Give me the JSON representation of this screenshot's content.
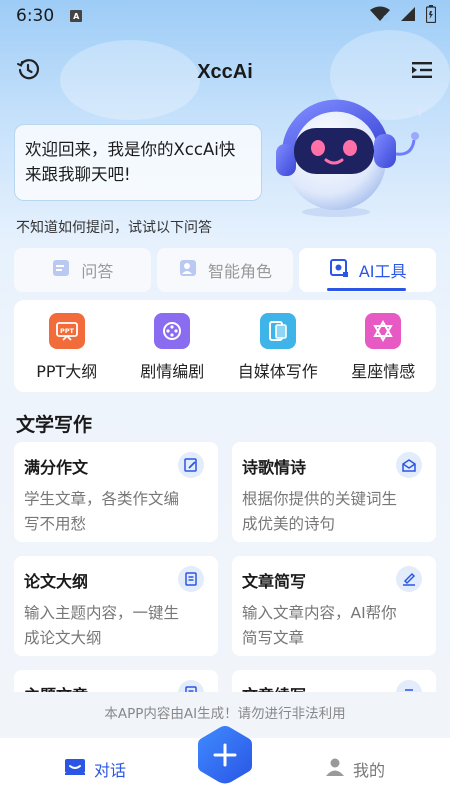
{
  "status": {
    "time": "6:30",
    "badge": "A"
  },
  "header": {
    "title": "XccAi"
  },
  "welcome": {
    "line1": "欢迎回来，我是你的XccAi快",
    "line2": "来跟我聊天吧!"
  },
  "hint": "不知道如何提问，试试以下问答",
  "tabs": [
    {
      "label": "问答",
      "icon": "qa-icon",
      "active": false
    },
    {
      "label": "智能角色",
      "icon": "role-icon",
      "active": false
    },
    {
      "label": "AI工具",
      "icon": "ai-tool-icon",
      "active": true
    }
  ],
  "tools": [
    {
      "label": "PPT大纲",
      "icon": "ppt-icon",
      "color": "#f26b3a"
    },
    {
      "label": "剧情编剧",
      "icon": "film-reel-icon",
      "color": "#8a6cf0"
    },
    {
      "label": "自媒体写作",
      "icon": "tablet-icon",
      "color": "#3fb4e8"
    },
    {
      "label": "星座情感",
      "icon": "star-of-david-icon",
      "color": "#e85ac3"
    }
  ],
  "section": {
    "title": "文学写作"
  },
  "cards": [
    {
      "title": "满分作文",
      "desc1": "学生文章，各类作文编",
      "desc2": "写不用愁",
      "icon": "edit-icon"
    },
    {
      "title": "诗歌情诗",
      "desc1": "根据你提供的关键词生",
      "desc2": "成优美的诗句",
      "icon": "mail-icon"
    },
    {
      "title": "论文大纲",
      "desc1": "输入主题内容，一键生",
      "desc2": "成论文大纲",
      "icon": "document-icon"
    },
    {
      "title": "文章简写",
      "desc1": "输入文章内容，AI帮你",
      "desc2": "简写文章",
      "icon": "pen-icon"
    },
    {
      "title": "主题文章",
      "icon": "document-icon"
    },
    {
      "title": "文章续写",
      "icon": "list-icon"
    }
  ],
  "disclaimer": "本APP内容由AI生成！请勿进行非法利用",
  "nav": {
    "chat": "对话",
    "mine": "我的"
  },
  "colors": {
    "accent": "#2a55e5"
  }
}
